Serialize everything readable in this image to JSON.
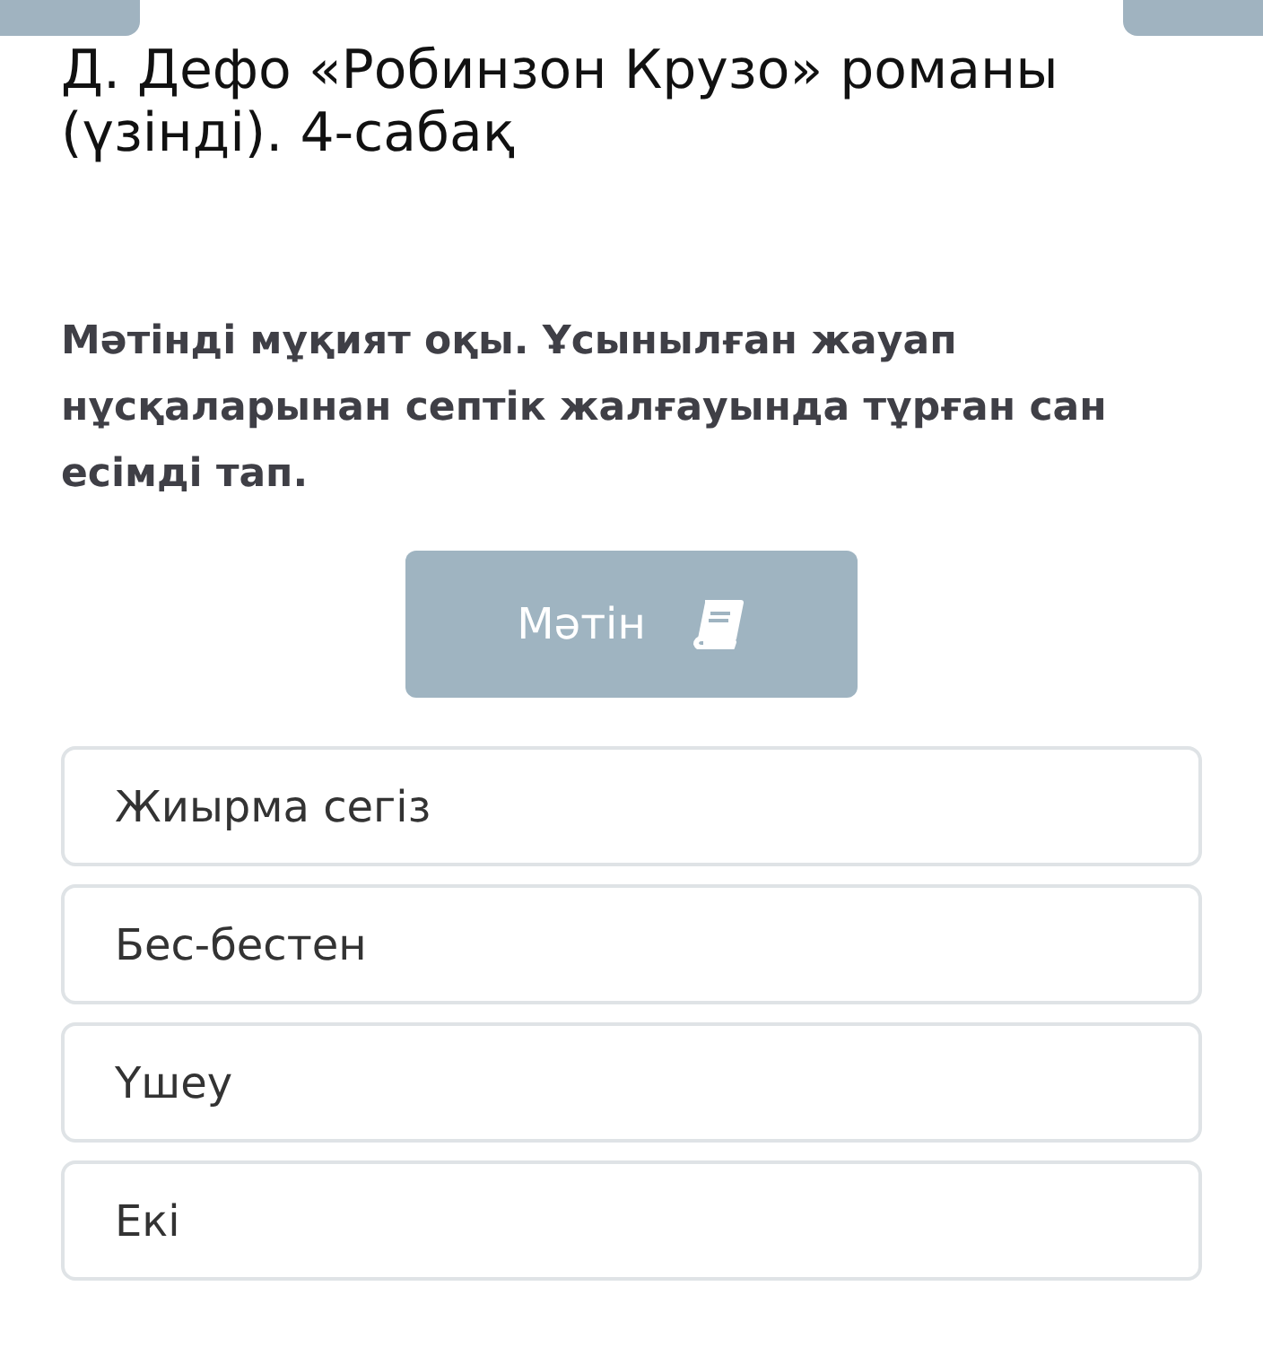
{
  "title": "Д. Дефо «Робинзон Крузо» романы (үзінді). 4-сабақ",
  "question": "Мәтінді мұқият оқы. Ұсынылған жауап нұсқаларынан септік жалғауында тұрған сан есімді тап.",
  "text_button": {
    "label": "Мәтін"
  },
  "options": [
    {
      "label": "Жиырма сегіз",
      "selected": false
    },
    {
      "label": "Бес-бестен",
      "selected": false
    },
    {
      "label": "Үшеу",
      "selected": false
    },
    {
      "label": "Екі",
      "selected": false
    }
  ]
}
